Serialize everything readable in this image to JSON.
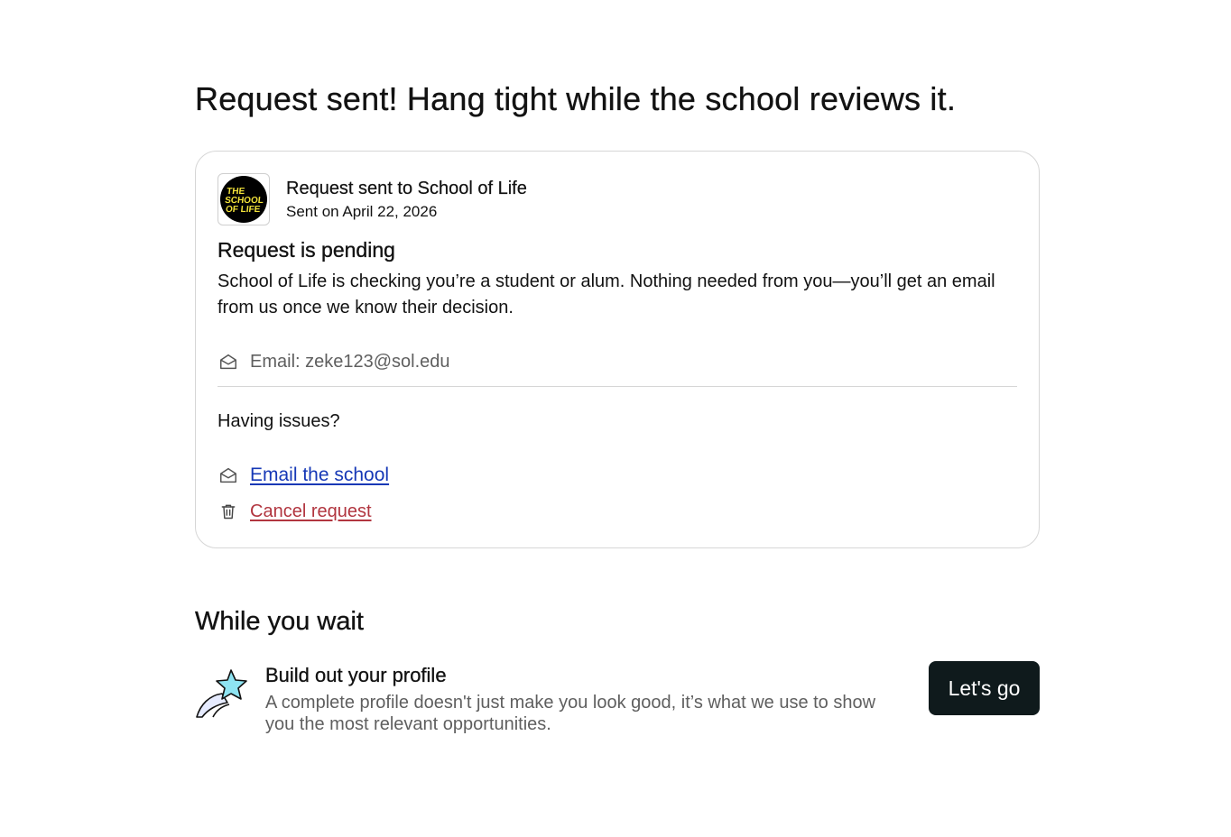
{
  "page": {
    "title": "Request sent! Hang tight while the school reviews it."
  },
  "request_card": {
    "logo_text": [
      "THE",
      "SCHOOL",
      "OF LIFE"
    ],
    "title": "Request sent to School of Life",
    "sent_date": "Sent on April 22, 2026",
    "status_title": "Request is pending",
    "status_body": "School of Life is checking you’re a student or alum. Nothing needed from you—you’ll get an email from us once we know their decision.",
    "email_line": "Email: zeke123@sol.edu",
    "issues_label": "Having issues?",
    "email_school_link": "Email the school",
    "cancel_link": "Cancel request"
  },
  "wait_section": {
    "title": "While you wait",
    "item_title": "Build out your profile",
    "item_description": "A complete profile doesn't just make you look good, it’s what we use to show you the most relevant opportunities.",
    "button_label": "Let's go"
  },
  "colors": {
    "link_blue": "#1638b6",
    "cancel_red": "#b1353f",
    "button_dark": "#0f1a1c",
    "logo_yellow": "#f2e23a",
    "star_fill": "#8ee4f2"
  },
  "icons": {
    "email": "envelope-open-icon",
    "cancel": "trash-icon",
    "profile": "shooting-star-icon"
  }
}
